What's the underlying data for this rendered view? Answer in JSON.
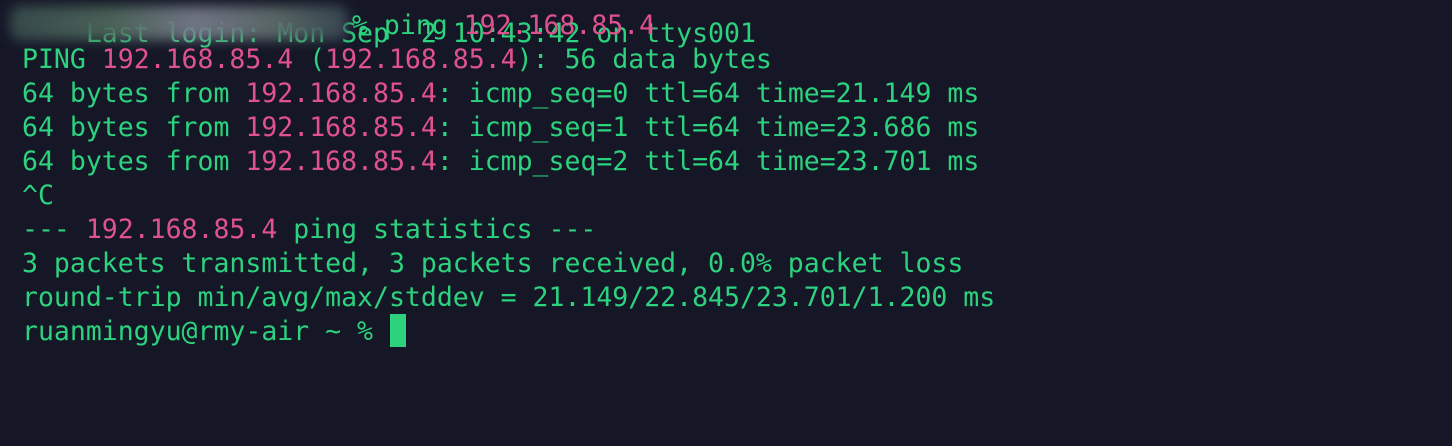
{
  "terminal": {
    "partial_top_line": "Last login: Mon Sep  2 10:43:42 on ttys001",
    "prompt_cmd": {
      "prefix": "% ping ",
      "ip": "192.168.85.4"
    },
    "ping_header": {
      "prefix": "PING ",
      "ip1": "192.168.85.4",
      "mid": " (",
      "ip2": "192.168.85.4",
      "suffix": "): 56 data bytes"
    },
    "replies": [
      {
        "prefix": "64 bytes from ",
        "ip": "192.168.85.4",
        "suffix": ": icmp_seq=0 ttl=64 time=21.149 ms"
      },
      {
        "prefix": "64 bytes from ",
        "ip": "192.168.85.4",
        "suffix": ": icmp_seq=1 ttl=64 time=23.686 ms"
      },
      {
        "prefix": "64 bytes from ",
        "ip": "192.168.85.4",
        "suffix": ": icmp_seq=2 ttl=64 time=23.701 ms"
      }
    ],
    "interrupt": "^C",
    "stats_header": {
      "prefix": "--- ",
      "ip": "192.168.85.4",
      "suffix": " ping statistics ---"
    },
    "stats_line": "3 packets transmitted, 3 packets received, 0.0% packet loss",
    "rtt_line": "round-trip min/avg/max/stddev = 21.149/22.845/23.701/1.200 ms",
    "final_prompt": "ruanmingyu@rmy-air ~ % "
  },
  "colors": {
    "background": "#151727",
    "text_green": "#2dd27e",
    "ip_pink": "#e0528e"
  }
}
